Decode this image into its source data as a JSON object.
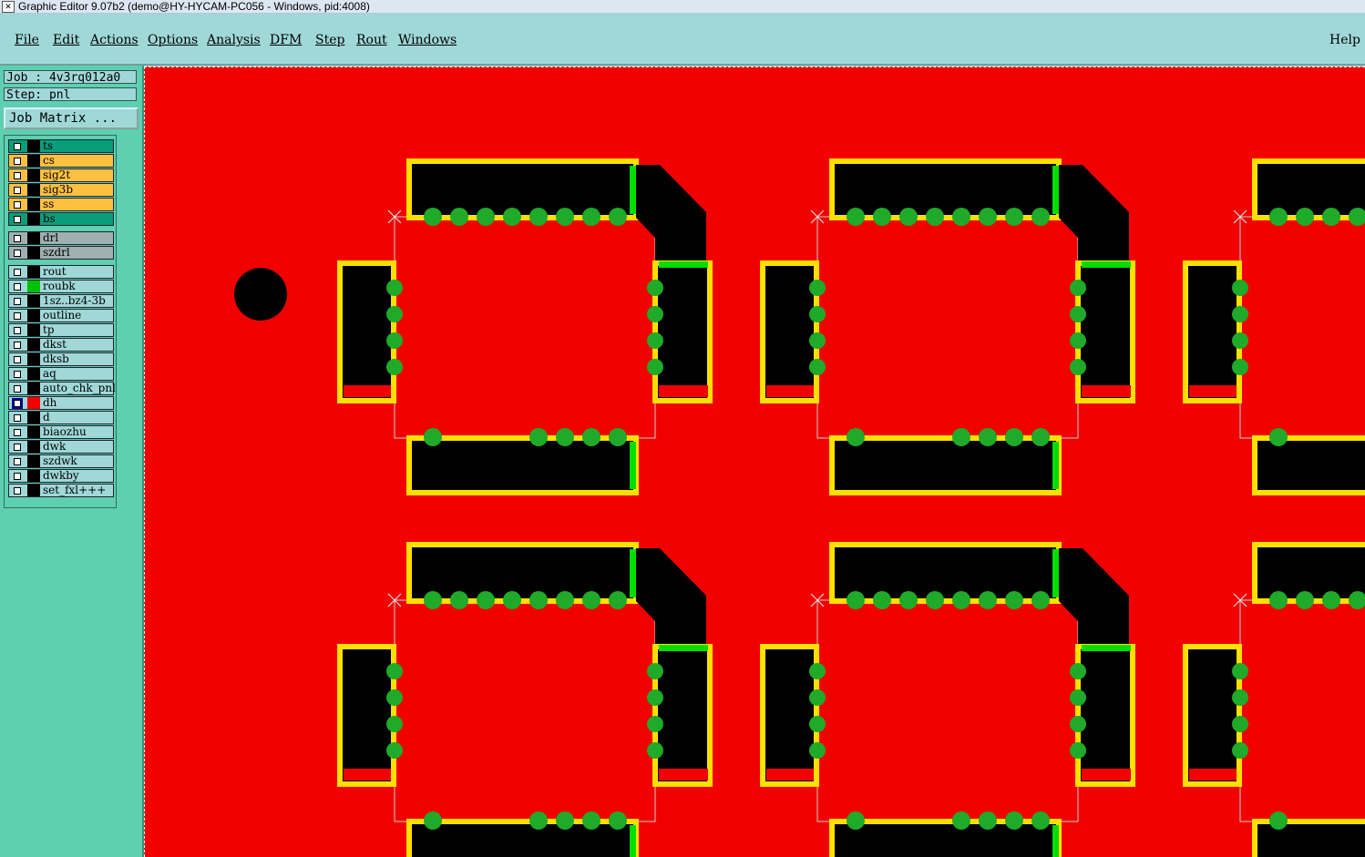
{
  "window": {
    "title": "Graphic Editor 9.07b2 (demo@HY-HYCAM-PC056 - Windows, pid:4008)"
  },
  "menu": {
    "items": [
      {
        "label": "File"
      },
      {
        "label": "Edit"
      },
      {
        "label": "Actions"
      },
      {
        "label": "Options"
      },
      {
        "label": "Analysis"
      },
      {
        "label": "DFM"
      },
      {
        "label": "Step"
      },
      {
        "label": "Rout"
      },
      {
        "label": "Windows"
      }
    ],
    "help": "Help"
  },
  "job": {
    "job_label": "Job : 4v3rq012a0",
    "step_label": "Step: pnl",
    "matrix_button": "Job Matrix ..."
  },
  "layers": [
    {
      "name": "ts",
      "bg": "#0a9d7a",
      "swatch": "#000000",
      "checked": false
    },
    {
      "name": "cs",
      "bg": "#ffc040",
      "swatch": "#000000",
      "checked": false
    },
    {
      "name": "sig2t",
      "bg": "#ffc040",
      "swatch": "#000000",
      "checked": false
    },
    {
      "name": "sig3b",
      "bg": "#ffc040",
      "swatch": "#000000",
      "checked": false
    },
    {
      "name": "ss",
      "bg": "#ffc040",
      "swatch": "#000000",
      "checked": false
    },
    {
      "name": "bs",
      "bg": "#0a9d7a",
      "swatch": "#000000",
      "checked": false
    },
    {
      "name": "drl",
      "bg": "#a0b0b0",
      "swatch": "#000000",
      "checked": false
    },
    {
      "name": "szdrl",
      "bg": "#a0b0b0",
      "swatch": "#000000",
      "checked": false
    },
    {
      "name": "rout",
      "bg": "#a0d8d8",
      "swatch": "#000000",
      "checked": false
    },
    {
      "name": "roubk",
      "bg": "#a0d8d8",
      "swatch": "#00c000",
      "checked": false
    },
    {
      "name": "1sz..bz4-3b",
      "bg": "#a0d8d8",
      "swatch": "#000000",
      "checked": false
    },
    {
      "name": "outline",
      "bg": "#a0d8d8",
      "swatch": "#000000",
      "checked": false
    },
    {
      "name": "tp",
      "bg": "#a0d8d8",
      "swatch": "#000000",
      "checked": false
    },
    {
      "name": "dkst",
      "bg": "#a0d8d8",
      "swatch": "#000000",
      "checked": false
    },
    {
      "name": "dksb",
      "bg": "#a0d8d8",
      "swatch": "#000000",
      "checked": false
    },
    {
      "name": "aq",
      "bg": "#a0d8d8",
      "swatch": "#000000",
      "checked": false
    },
    {
      "name": "auto_chk_pnl",
      "bg": "#a0d8d8",
      "swatch": "#000000",
      "checked": false
    },
    {
      "name": "dh",
      "bg": "#a0d8d8",
      "swatch": "#f20000",
      "checked": true
    },
    {
      "name": "d",
      "bg": "#a0d8d8",
      "swatch": "#000000",
      "checked": false
    },
    {
      "name": "biaozhu",
      "bg": "#a0d8d8",
      "swatch": "#000000",
      "checked": false
    },
    {
      "name": "dwk",
      "bg": "#a0d8d8",
      "swatch": "#000000",
      "checked": false
    },
    {
      "name": "szdwk",
      "bg": "#a0d8d8",
      "swatch": "#000000",
      "checked": false
    },
    {
      "name": "dwkby",
      "bg": "#a0d8d8",
      "swatch": "#000000",
      "checked": false
    },
    {
      "name": "set_fxl+++",
      "bg": "#a0d8d8",
      "swatch": "#000000",
      "checked": false
    }
  ],
  "colors": {
    "canvas_bg": "#f20000",
    "pad_fill": "#000000",
    "pad_outline": "#ffe000",
    "via": "#1faa2a",
    "accent_green": "#00dd00",
    "panel_bg": "#5ecfb0",
    "menu_bg": "#a0d8d8"
  }
}
